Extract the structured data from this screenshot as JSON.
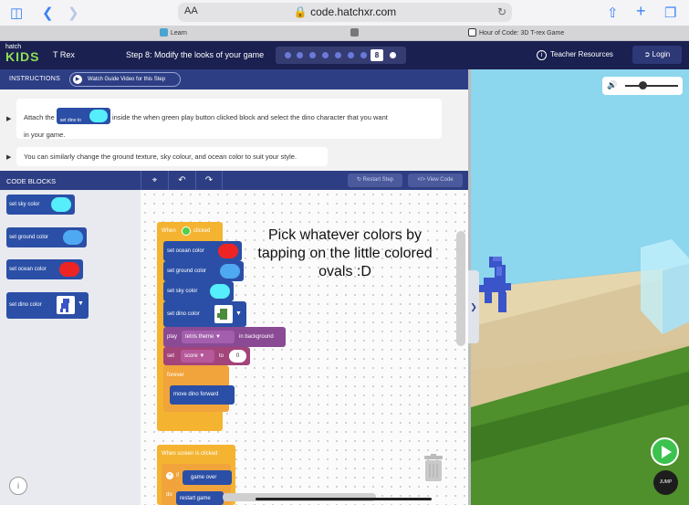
{
  "browser": {
    "url_aa": "AA",
    "url": "code.hatchxr.com",
    "tabs": [
      {
        "label": "Learn"
      },
      {
        "label": ""
      },
      {
        "label": "Hour of Code: 3D T-rex Game"
      }
    ]
  },
  "header": {
    "logo_top": "hatch",
    "logo_bottom": "KIDS",
    "project_title": "T Rex",
    "step_title": "Step 8: Modify the looks of your game",
    "current_step": "8",
    "teacher_resources": "Teacher Resources",
    "login": "Login"
  },
  "instructions": {
    "label": "INSTRUCTIONS",
    "guide_button": "Watch Guide Video for this Step",
    "step1_before": "Attach the",
    "step1_block": "set dino to",
    "step1_after": "inside the when green play button clicked block and select the dino character that you want",
    "step1_line2": "in your game.",
    "step2": "You can similarly change the ground texture, sky colour, and ocean color to suit your style."
  },
  "code_blocks": {
    "label": "CODE BLOCKS",
    "restart_step": "Restart Step",
    "view_code": "View Code",
    "palette": [
      {
        "label": "set sky color",
        "color": "#55eefa"
      },
      {
        "label": "set ground color",
        "color": "#4fa8f2"
      },
      {
        "label": "set ocean color",
        "color": "#ee2424"
      },
      {
        "label": "set dino color"
      }
    ]
  },
  "workspace": {
    "annotation": "Pick whatever colors by tapping on the little colored ovals :D",
    "when_clicked": "When",
    "clicked": "clicked",
    "set_ocean": "set ocean color",
    "set_ground": "set ground color",
    "set_sky": "set sky color",
    "set_dino": "set dino color",
    "play": "play",
    "theme": "tetris theme",
    "in_background": "in background",
    "set": "set",
    "score": "score",
    "to": "to",
    "score_value": "0",
    "forever": "forever",
    "move_forward": "move dino forward",
    "when_screen": "When screen is clicked",
    "if": "if",
    "game_over": "game over",
    "do": "do",
    "restart": "restart game"
  },
  "scene": {
    "jump": "JUMP"
  },
  "colors": {
    "header": "#1a2050",
    "panel": "#2d3e84",
    "block_blue": "#2b4fa6",
    "event_yellow": "#f4b432",
    "sound_purple": "#8a4a94",
    "variable_pink": "#a3447b",
    "control_orange": "#f1a43b"
  }
}
